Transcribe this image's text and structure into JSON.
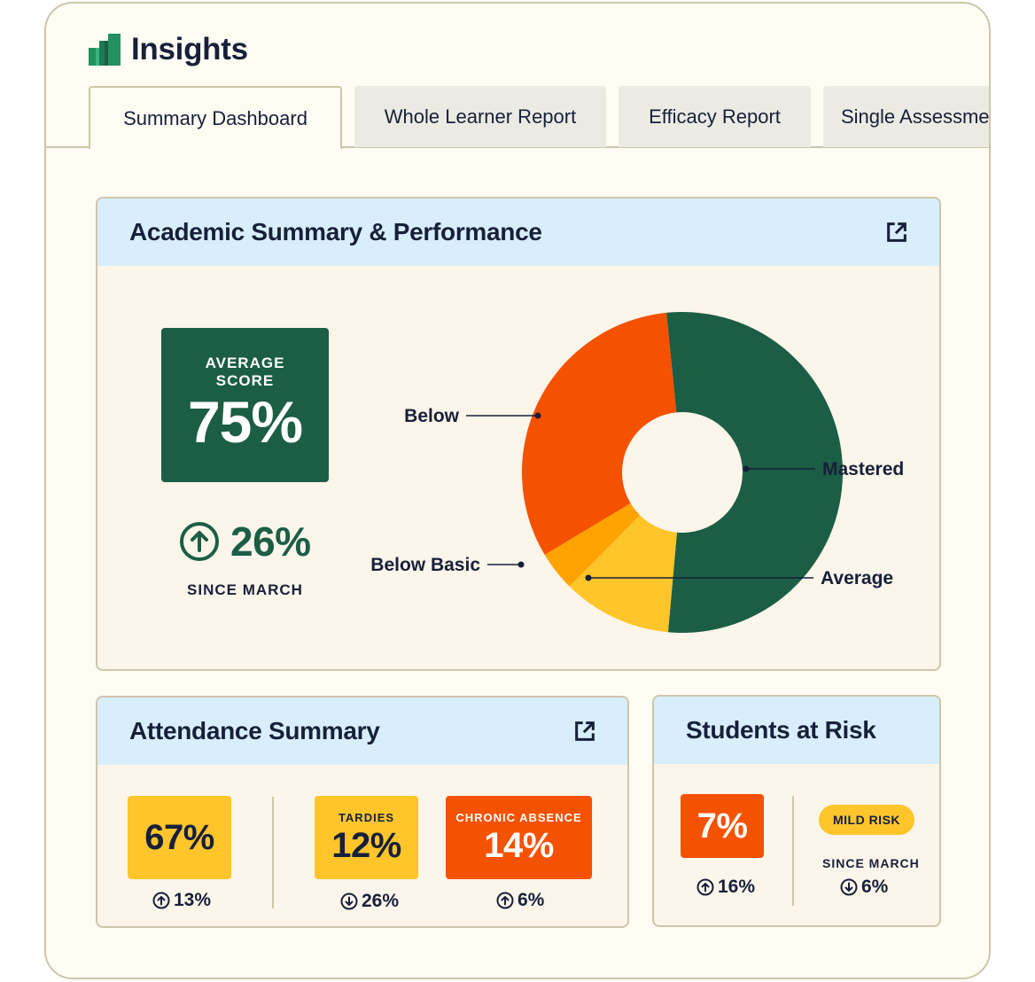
{
  "app": {
    "title": "Insights",
    "icon": "bar-chart-logo-icon"
  },
  "tabs": [
    {
      "label": "Summary Dashboard",
      "active": true
    },
    {
      "label": "Whole Learner Report",
      "active": false
    },
    {
      "label": "Efficacy Report",
      "active": false
    },
    {
      "label": "Single Assessment",
      "active": false
    }
  ],
  "academic": {
    "title": "Academic Summary & Performance",
    "external_icon": "external-link-icon",
    "average_score_label": "AVERAGE SCORE",
    "average_score_value": "75%",
    "trend_direction": "up",
    "trend_value": "26%",
    "trend_caption": "SINCE MARCH"
  },
  "attendance": {
    "title": "Attendance Summary",
    "external_icon": "external-link-icon",
    "items": [
      {
        "label": "",
        "value": "67%",
        "delta_direction": "up",
        "delta": "13%"
      },
      {
        "label": "TARDIES",
        "value": "12%",
        "delta_direction": "down",
        "delta": "26%"
      },
      {
        "label": "CHRONIC ABSENCE",
        "value": "14%",
        "delta_direction": "up",
        "delta": "6%"
      }
    ]
  },
  "risk": {
    "title": "Students at Risk",
    "value": "7%",
    "delta_direction": "up",
    "delta": "16%",
    "badge": "MILD RISK",
    "caption": "SINCE MARCH",
    "caption_delta_direction": "down",
    "caption_delta": "6%"
  },
  "colors": {
    "brand_green": "#1b5e45",
    "orange": "#f55200",
    "amber": "#ffa300",
    "yellow": "#ffc52b",
    "header_blue": "#d8eefd",
    "ink": "#17203a"
  },
  "chart_data": {
    "type": "pie",
    "variant": "donut",
    "title": "Academic Summary & Performance",
    "categories": [
      "Mastered",
      "Average",
      "Below Basic",
      "Below"
    ],
    "values": [
      53,
      11,
      4,
      32
    ],
    "unit": "percent (estimated from slice angles)",
    "colors": [
      "#1b5e45",
      "#ffc52b",
      "#ffa300",
      "#f55200"
    ],
    "start_angle_deg": -5.7,
    "direction": "clockwise",
    "labels_placement": "callout lines"
  }
}
